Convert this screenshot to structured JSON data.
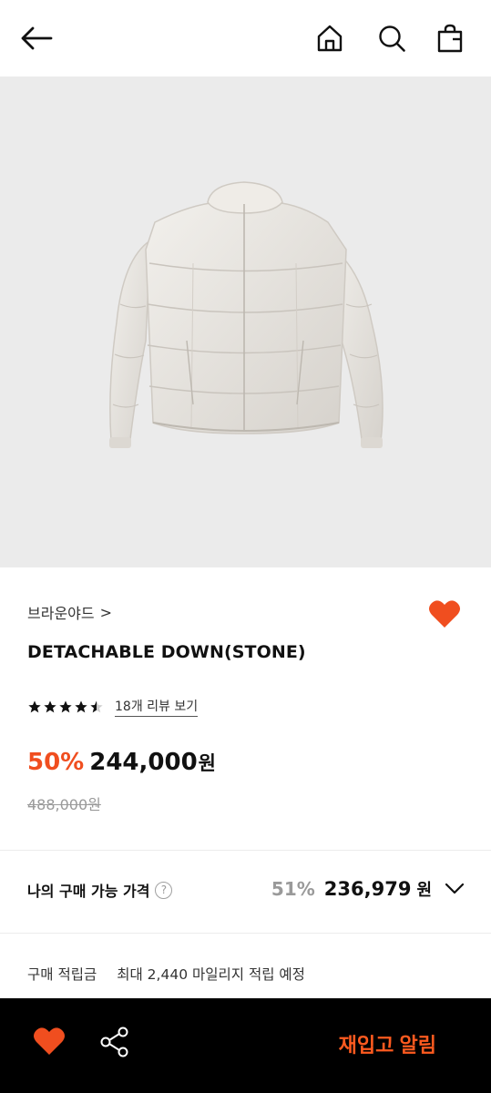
{
  "header": {
    "back_icon": "arrow-left-icon",
    "home_icon": "home-icon",
    "search_icon": "search-icon",
    "bag_icon": "shopping-bag-icon"
  },
  "product": {
    "image_alt_name": "puffer-jacket-image",
    "brand": "브라운야드",
    "brand_chevron": ">",
    "title": "DETACHABLE DOWN(STONE)",
    "wishlisted": true,
    "rating": 4.5,
    "review_link": "18개 리뷰 보기",
    "discount": "50%",
    "price": "244,000",
    "currency": "원",
    "original_price": "488,000원"
  },
  "my_price": {
    "label": "나의 구매 가능 가격",
    "help": "?",
    "discount": "51%",
    "price": "236,979",
    "currency": "원"
  },
  "points": {
    "label": "구매 적립금",
    "value": "최대 2,440 마일리지 적립 예정"
  },
  "bottom": {
    "restock_label": "재입고 알림"
  },
  "colors": {
    "accent": "#f04e1f",
    "restock": "#ff5a1f",
    "hero_bg": "#ebebeb"
  }
}
